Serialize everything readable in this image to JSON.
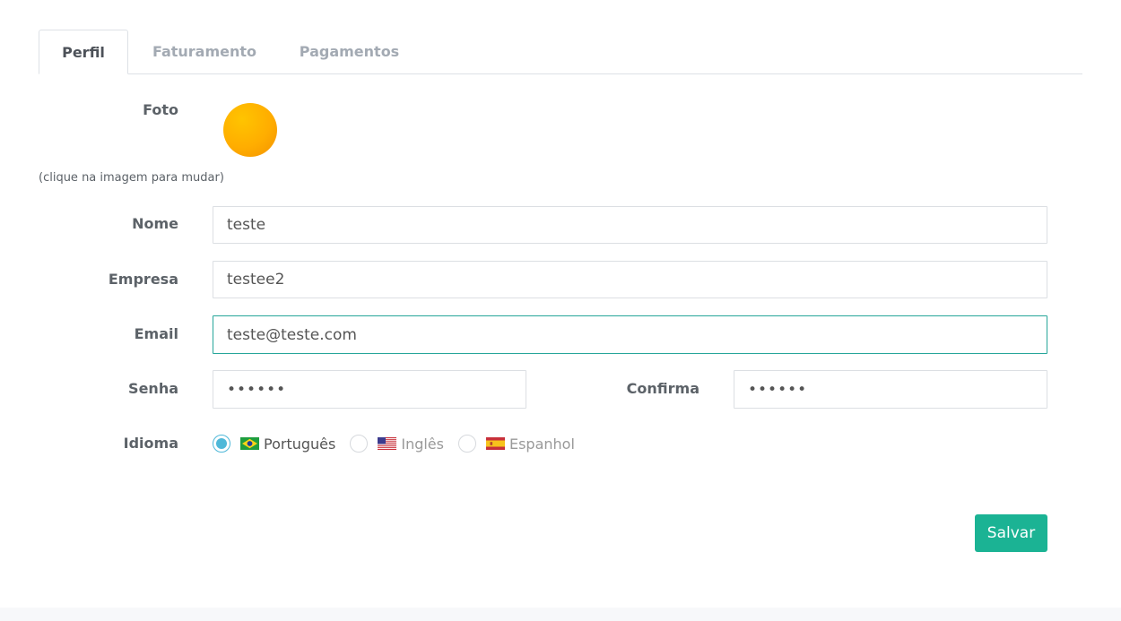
{
  "tabs": [
    {
      "label": "Perfil",
      "active": true
    },
    {
      "label": "Faturamento",
      "active": false
    },
    {
      "label": "Pagamentos",
      "active": false
    }
  ],
  "profile": {
    "photo_label": "Foto",
    "photo_hint": "(clique na imagem para mudar)",
    "name_label": "Nome",
    "name_value": "teste",
    "company_label": "Empresa",
    "company_value": "testee2",
    "email_label": "Email",
    "email_value": "teste@teste.com",
    "password_label": "Senha",
    "password_value": "••••••",
    "confirm_label": "Confirma",
    "confirm_value": "••••••",
    "language_label": "Idioma",
    "languages": [
      {
        "label": "Português",
        "flag": "brazil-flag-icon",
        "selected": true
      },
      {
        "label": "Inglês",
        "flag": "usa-flag-icon",
        "selected": false
      },
      {
        "label": "Espanhol",
        "flag": "spain-flag-icon",
        "selected": false
      }
    ]
  },
  "actions": {
    "save_label": "Salvar"
  },
  "colors": {
    "accent": "#1bb394",
    "focus_border": "#26a69a",
    "radio_checked": "#4fb8d8"
  }
}
